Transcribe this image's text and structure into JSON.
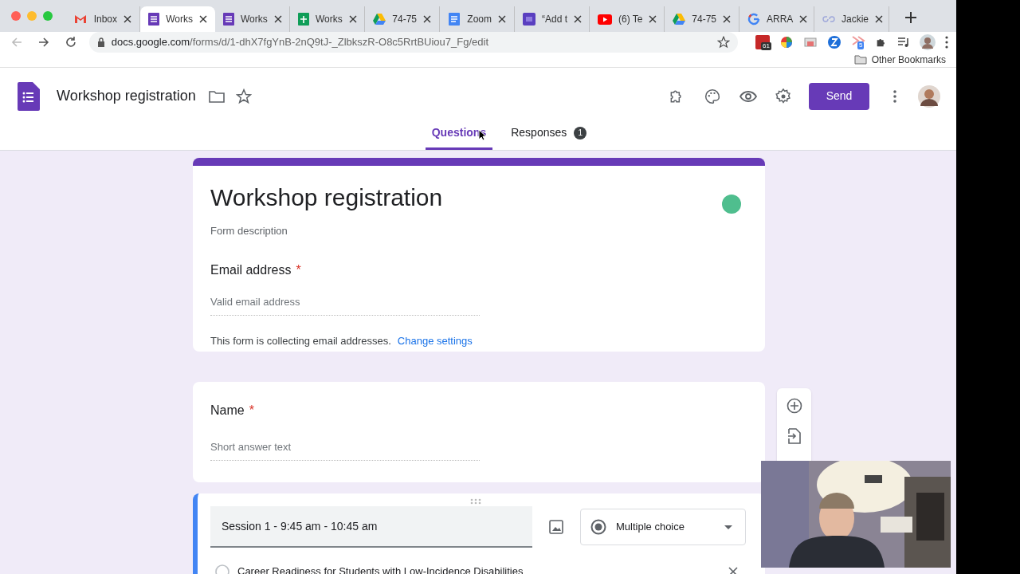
{
  "browser": {
    "tabs": [
      {
        "label": "Inbox",
        "kind": "gmail",
        "selected": false
      },
      {
        "label": "Works",
        "kind": "forms",
        "selected": true
      },
      {
        "label": "Works",
        "kind": "forms",
        "selected": false
      },
      {
        "label": "Works",
        "kind": "sheets",
        "selected": false
      },
      {
        "label": "74-75",
        "kind": "drive",
        "selected": false
      },
      {
        "label": "Zoom",
        "kind": "docs",
        "selected": false
      },
      {
        "label": "“Add t",
        "kind": "di",
        "selected": false
      },
      {
        "label": "(6) Te",
        "kind": "youtube",
        "selected": false
      },
      {
        "label": "74-75",
        "kind": "drive",
        "selected": false
      },
      {
        "label": "ARRA",
        "kind": "google",
        "selected": false
      },
      {
        "label": "Jackie",
        "kind": "link",
        "selected": false
      }
    ],
    "url": {
      "host": "docs.google.com",
      "path": "/forms/d/1-dhX7fgYnB-2nQ9tJ-_ZlbkszR-O8c5RrtBUiou7_Fg/edit"
    },
    "extension_badges": [
      "61",
      "5"
    ],
    "bookmarks": [
      "Other Bookmarks"
    ]
  },
  "app": {
    "title": "Workshop registration",
    "send": "Send",
    "tabs": [
      {
        "label": "Questions",
        "selected": true
      },
      {
        "label": "Responses",
        "selected": false,
        "count": "1"
      }
    ]
  },
  "form": {
    "title": "Workshop registration",
    "description_placeholder": "Form description",
    "questions": [
      {
        "kind": "email",
        "title": "Email address",
        "required_mark": "*",
        "placeholder": "Valid email address",
        "note": "This form is collecting email addresses.",
        "link": "Change settings"
      },
      {
        "kind": "short_answer",
        "title": "Name",
        "required_mark": "*",
        "placeholder": "Short answer text"
      },
      {
        "kind": "multiple_choice",
        "title": "Session 1 - 9:45 am - 10:45 am",
        "type": "Multiple choice",
        "options": [
          {
            "label": "Career Readiness for Students with Low-Incidence Disabilities"
          }
        ]
      }
    ]
  }
}
